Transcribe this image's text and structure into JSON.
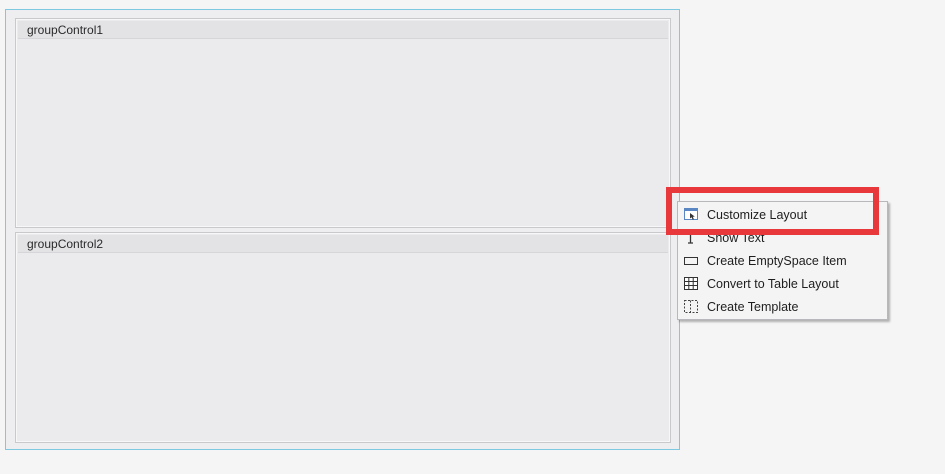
{
  "groups": [
    {
      "caption": "groupControl1"
    },
    {
      "caption": "groupControl2"
    }
  ],
  "context_menu": {
    "items": [
      {
        "label": "Customize Layout",
        "icon": "customize-layout-icon"
      },
      {
        "label": "Show Text",
        "icon": "text-cursor-icon"
      },
      {
        "label": "Create EmptySpace Item",
        "icon": "empty-space-icon"
      },
      {
        "label": "Convert to Table Layout",
        "icon": "table-grid-icon"
      },
      {
        "label": "Create Template",
        "icon": "template-icon"
      }
    ]
  },
  "colors": {
    "highlight": "#e8383b",
    "layout_border": "#7fc9e0",
    "background": "#f5f5f5"
  }
}
